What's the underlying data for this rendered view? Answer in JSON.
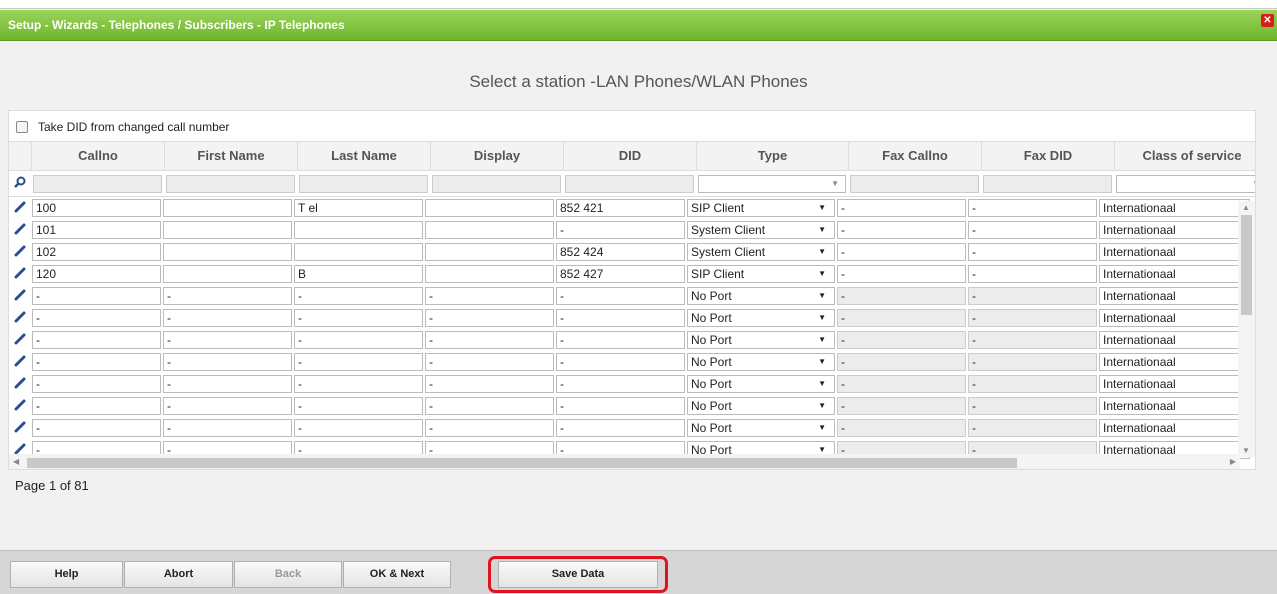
{
  "window": {
    "title": "Setup - Wizards - Telephones / Subscribers - IP Telephones",
    "close_label": "✕"
  },
  "subtitle": "Select a station -LAN Phones/WLAN Phones",
  "take_did": {
    "label": "Take DID from changed call number",
    "checked": false
  },
  "columns": [
    "Callno",
    "First Name",
    "Last Name",
    "Display",
    "DID",
    "Type",
    "Fax Callno",
    "Fax DID",
    "Class of service"
  ],
  "rows": [
    {
      "callno": "100",
      "first": "",
      "last": "T    el",
      "display": "",
      "did": "852   421",
      "type": "SIP Client",
      "fax_callno": "-",
      "fax_did": "-",
      "cos": "Internationaal",
      "fax_enabled": true
    },
    {
      "callno": "101",
      "first": "",
      "last": "",
      "display": "",
      "did": "-",
      "type": "System Client",
      "fax_callno": "-",
      "fax_did": "-",
      "cos": "Internationaal",
      "fax_enabled": true
    },
    {
      "callno": "102",
      "first": "",
      "last": "",
      "display": "",
      "did": "852     424",
      "type": "System Client",
      "fax_callno": "-",
      "fax_did": "-",
      "cos": "Internationaal",
      "fax_enabled": true
    },
    {
      "callno": "120",
      "first": "",
      "last": "B",
      "display": "",
      "did": "852    427",
      "type": "SIP Client",
      "fax_callno": "-",
      "fax_did": "-",
      "cos": "Internationaal",
      "fax_enabled": true
    },
    {
      "callno": "-",
      "first": "-",
      "last": "-",
      "display": "-",
      "did": "-",
      "type": "No Port",
      "fax_callno": "-",
      "fax_did": "-",
      "cos": "Internationaal",
      "fax_enabled": false
    },
    {
      "callno": "-",
      "first": "-",
      "last": "-",
      "display": "-",
      "did": "-",
      "type": "No Port",
      "fax_callno": "-",
      "fax_did": "-",
      "cos": "Internationaal",
      "fax_enabled": false
    },
    {
      "callno": "-",
      "first": "-",
      "last": "-",
      "display": "-",
      "did": "-",
      "type": "No Port",
      "fax_callno": "-",
      "fax_did": "-",
      "cos": "Internationaal",
      "fax_enabled": false
    },
    {
      "callno": "-",
      "first": "-",
      "last": "-",
      "display": "-",
      "did": "-",
      "type": "No Port",
      "fax_callno": "-",
      "fax_did": "-",
      "cos": "Internationaal",
      "fax_enabled": false
    },
    {
      "callno": "-",
      "first": "-",
      "last": "-",
      "display": "-",
      "did": "-",
      "type": "No Port",
      "fax_callno": "-",
      "fax_did": "-",
      "cos": "Internationaal",
      "fax_enabled": false
    },
    {
      "callno": "-",
      "first": "-",
      "last": "-",
      "display": "-",
      "did": "-",
      "type": "No Port",
      "fax_callno": "-",
      "fax_did": "-",
      "cos": "Internationaal",
      "fax_enabled": false
    },
    {
      "callno": "-",
      "first": "-",
      "last": "-",
      "display": "-",
      "did": "-",
      "type": "No Port",
      "fax_callno": "-",
      "fax_did": "-",
      "cos": "Internationaal",
      "fax_enabled": false
    },
    {
      "callno": "-",
      "first": "-",
      "last": "-",
      "display": "-",
      "did": "-",
      "type": "No Port",
      "fax_callno": "-",
      "fax_did": "-",
      "cos": "Internationaal",
      "fax_enabled": false
    }
  ],
  "page_info": "Page 1 of 81",
  "buttons": {
    "help": "Help",
    "abort": "Abort",
    "back": "Back",
    "ok_next": "OK & Next",
    "save": "Save Data"
  },
  "colors": {
    "title_bar": "#7cc03a",
    "highlight": "#e0141e",
    "pencil": "#2b4f8a"
  }
}
